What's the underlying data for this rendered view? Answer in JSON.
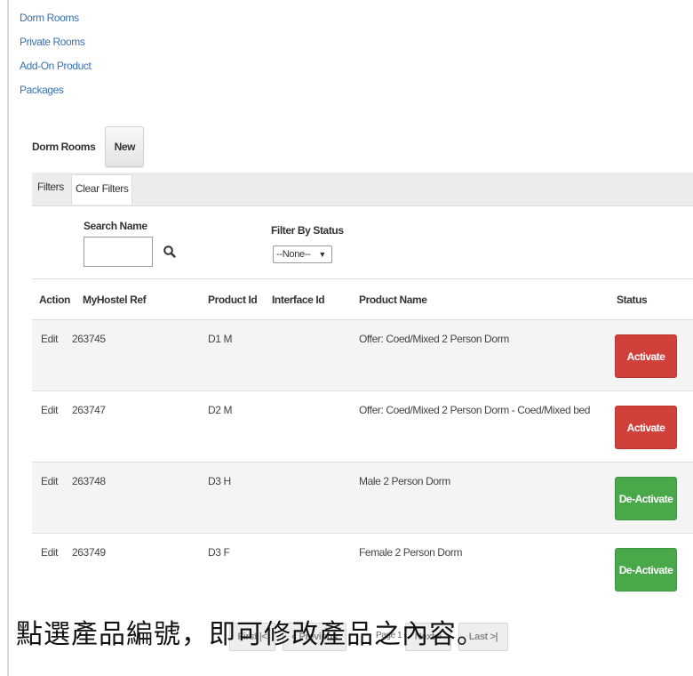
{
  "nav": {
    "links": [
      "Dorm Rooms",
      "Private Rooms",
      "Add-On Product",
      "Packages"
    ]
  },
  "section": {
    "title": "Dorm Rooms",
    "new_button": "New"
  },
  "filters": {
    "tab_label": "Filters",
    "clear_label": "Clear Filters",
    "search_label": "Search Name",
    "search_value": "",
    "status_label": "Filter By Status",
    "status_selected": "--None--"
  },
  "table": {
    "headers": {
      "action": "Action",
      "ref": "MyHostel Ref",
      "product_id": "Product Id",
      "interface_id": "Interface Id",
      "product_name": "Product Name",
      "status": "Status"
    },
    "rows": [
      {
        "action": "Edit",
        "ref": "263745",
        "product_id": "D1 M",
        "interface_id": "",
        "product_name": "Offer: Coed/Mixed 2 Person Dorm",
        "status_button": "Activate"
      },
      {
        "action": "Edit",
        "ref": "263747",
        "product_id": "D2 M",
        "interface_id": "",
        "product_name": "Offer: Coed/Mixed 2 Person Dorm - Coed/Mixed bed",
        "status_button": "Activate"
      },
      {
        "action": "Edit",
        "ref": "263748",
        "product_id": "D3 H",
        "interface_id": "",
        "product_name": "Male 2 Person Dorm",
        "status_button": "De-Activate"
      },
      {
        "action": "Edit",
        "ref": "263749",
        "product_id": "D3 F",
        "interface_id": "",
        "product_name": "Female 2 Person Dorm",
        "status_button": "De-Activate"
      }
    ]
  },
  "pager": {
    "first": "First |<",
    "previous": "« Previous",
    "info": "Page 1 of 1",
    "next": "Next »",
    "last": "Last >|"
  },
  "caption": "點選產品編號，即可修改產品之內容。",
  "colors": {
    "link": "#3a6fb0",
    "activate": "#d0413c",
    "deactivate": "#48a84a"
  },
  "icons": {
    "search": "search-icon",
    "select_caret": "caret-down-icon"
  }
}
